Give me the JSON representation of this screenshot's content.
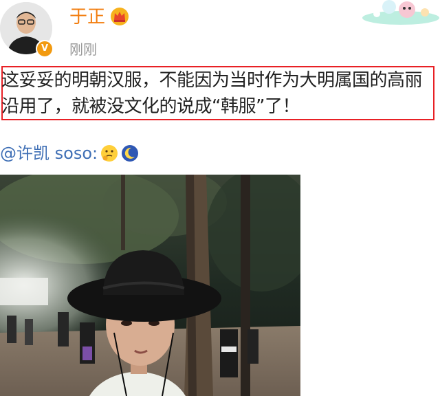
{
  "post": {
    "author": "于正",
    "time": "刚刚",
    "text": "这妥妥的明朝汉服，不能因为当时作为大明属国的高丽沿用了，就被没文化的说成“韩服”了！",
    "mention": "@许凯 soso:",
    "emojis": [
      "thinking-face-icon",
      "moon-sleep-icon"
    ]
  },
  "colors": {
    "author": "#f27d0f",
    "mention": "#3f6fb5",
    "highlight_border": "#e82025",
    "muted": "#999999"
  },
  "photo": {
    "description_icon": "selfie-in-black-hat-night-forest-film-set"
  }
}
